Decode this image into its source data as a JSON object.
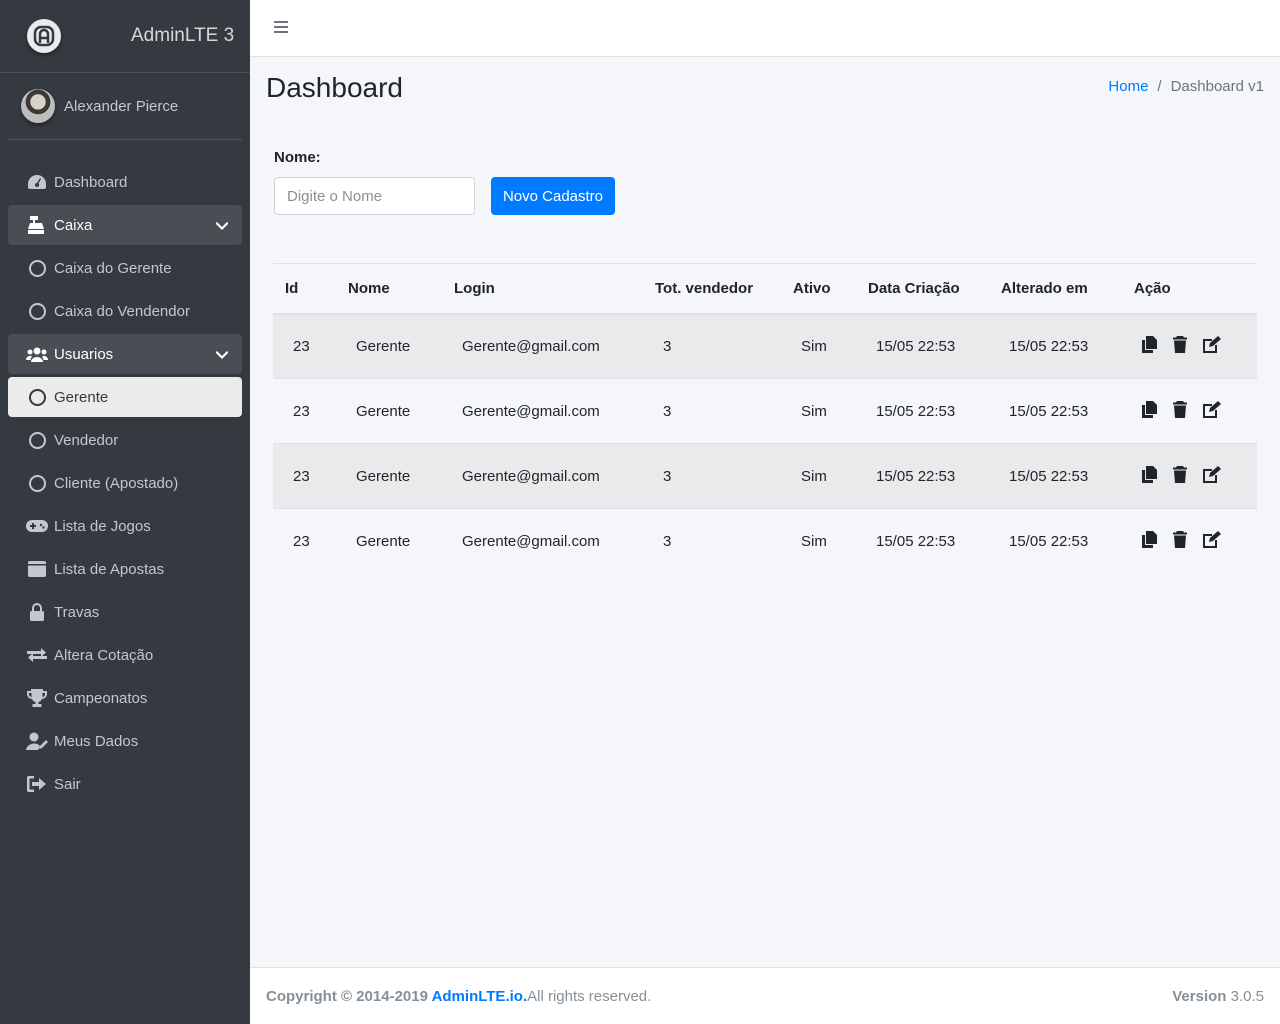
{
  "brand": {
    "name": "AdminLTE 3"
  },
  "user": {
    "name": "Alexander Pierce"
  },
  "sidebar": {
    "items": [
      {
        "label": "Dashboard",
        "icon": "dashboard-gauge-icon"
      },
      {
        "label": "Caixa",
        "icon": "cash-register-icon"
      },
      {
        "label": "Caixa do Gerente",
        "icon": "circle-icon"
      },
      {
        "label": "Caixa do Vendendor",
        "icon": "circle-icon"
      },
      {
        "label": "Usuarios",
        "icon": "users-icon"
      },
      {
        "label": "Gerente",
        "icon": "circle-icon"
      },
      {
        "label": "Vendedor",
        "icon": "circle-icon"
      },
      {
        "label": "Cliente (Apostado)",
        "icon": "circle-icon"
      },
      {
        "label": "Lista de Jogos",
        "icon": "gamepad-icon"
      },
      {
        "label": "Lista de Apostas",
        "icon": "wallet-icon"
      },
      {
        "label": "Travas",
        "icon": "lock-icon"
      },
      {
        "label": "Altera Cotação",
        "icon": "exchange-icon"
      },
      {
        "label": "Campeonatos",
        "icon": "trophy-icon"
      },
      {
        "label": "Meus Dados",
        "icon": "user-edit-icon"
      },
      {
        "label": "Sair",
        "icon": "sign-out-icon"
      }
    ]
  },
  "header": {
    "title": "Dashboard",
    "breadcrumb": {
      "home": "Home",
      "separator": "/",
      "current": "Dashboard v1"
    }
  },
  "form": {
    "label": "Nome:",
    "placeholder": "Digite o Nome",
    "value": "",
    "button": "Novo Cadastro"
  },
  "table": {
    "headers": [
      "Id",
      "Nome",
      "Login",
      "Tot. vendedor",
      "Ativo",
      "Data Criação",
      "Alterado em",
      "Ação"
    ],
    "rows": [
      [
        "23",
        "Gerente",
        "Gerente@gmail.com",
        "3",
        "Sim",
        "15/05 22:53",
        "15/05 22:53"
      ],
      [
        "23",
        "Gerente",
        "Gerente@gmail.com",
        "3",
        "Sim",
        "15/05 22:53",
        "15/05 22:53"
      ],
      [
        "23",
        "Gerente",
        "Gerente@gmail.com",
        "3",
        "Sim",
        "15/05 22:53",
        "15/05 22:53"
      ],
      [
        "23",
        "Gerente",
        "Gerente@gmail.com",
        "3",
        "Sim",
        "15/05 22:53",
        "15/05 22:53"
      ]
    ]
  },
  "footer": {
    "copyright": "Copyright © 2014-2019 ",
    "link": "AdminLTE.io.",
    "rights": "All rights reserved.",
    "version_label": "Version",
    "version": "3.0.5"
  },
  "colors": {
    "sidebar": "#343a40",
    "primary": "#007bff",
    "content_bg": "#f4f6f9"
  }
}
